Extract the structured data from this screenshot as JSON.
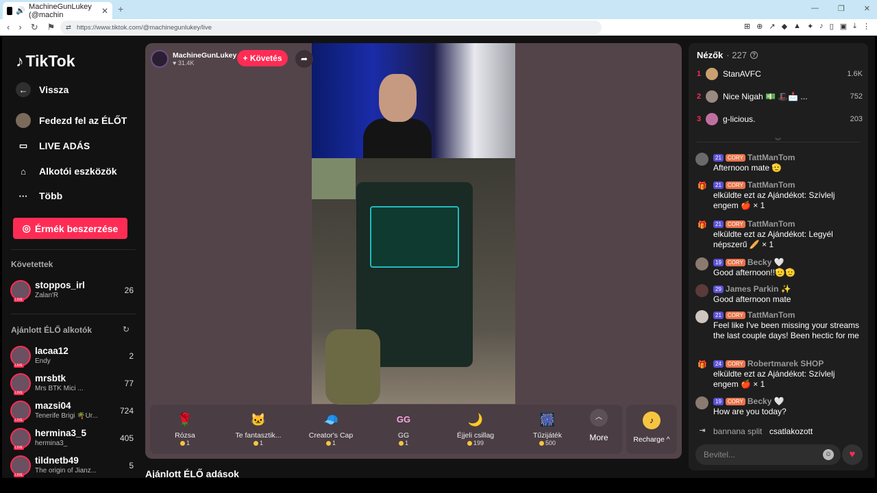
{
  "browser": {
    "tab_title": "MachineGunLukey (@machin",
    "url": "https://www.tiktok.com/@machinegunlukey/live"
  },
  "sidebar": {
    "logo": "TikTok",
    "back": "Vissza",
    "nav": [
      "Fedezd fel az ÉLŐT",
      "LIVE ADÁS",
      "Alkotói eszközök",
      "Több"
    ],
    "coins_button": "Érmék beszerzése",
    "following_title": "Követettek",
    "following": [
      {
        "name": "stoppos_irl",
        "sub": "Zalan'R",
        "count": "26"
      }
    ],
    "recommended_title": "Ajánlott ÉLŐ alkotók",
    "recommended": [
      {
        "name": "lacaa12",
        "sub": "Endy",
        "count": "2"
      },
      {
        "name": "mrsbtk",
        "sub": "Mrs BTK Mici ...",
        "count": "77"
      },
      {
        "name": "mazsi04",
        "sub": "Tenerife Brigi 🌴Úr...",
        "count": "724"
      },
      {
        "name": "hermina3_5",
        "sub": "hermina3_",
        "count": "405"
      },
      {
        "name": "tildnetb49",
        "sub": "The origin of Jianz...",
        "count": "5"
      }
    ]
  },
  "stream": {
    "name": "MachineGunLukey",
    "likes": "31.4K",
    "follow": "+ Követés",
    "gifts": [
      {
        "name": "Rózsa",
        "price": "1",
        "icon": "🌹"
      },
      {
        "name": "Te fantasztik...",
        "price": "1",
        "icon": "🐱"
      },
      {
        "name": "Creator's Cap",
        "price": "1",
        "icon": "🧢"
      },
      {
        "name": "GG",
        "price": "1",
        "icon": "GG"
      },
      {
        "name": "Éjjeli csillag",
        "price": "199",
        "icon": "🌙"
      },
      {
        "name": "Tűzijáték",
        "price": "500",
        "icon": "🎆"
      }
    ],
    "more": "More",
    "recharge": "Recharge ^",
    "suggested_title": "Ajánlott ÉLŐ adások"
  },
  "chat": {
    "viewers_label": "Nézők",
    "viewers_count": "· 227",
    "top": [
      {
        "rank": "1",
        "name": "StanAVFC",
        "score": "1.6K"
      },
      {
        "rank": "2",
        "name": "Nice Nigah 💵 🎩📩 ...",
        "score": "752"
      },
      {
        "rank": "3",
        "name": "g-licious.",
        "score": "203"
      }
    ],
    "messages": [
      {
        "level": "21",
        "fan": "CORY",
        "user": "TattManTom",
        "text": "Afternoon mate 🫡",
        "gift": false
      },
      {
        "level": "21",
        "fan": "CORY",
        "user": "TattManTom",
        "text": "elküldte ezt az Ajándékot: Szívlelj engem 🍎 × 1",
        "gift": true
      },
      {
        "level": "21",
        "fan": "CORY",
        "user": "TattManTom",
        "text": "elküldte ezt az Ajándékot: Legyél népszerű 🥖 × 1",
        "gift": true
      },
      {
        "level": "19",
        "fan": "CORY",
        "user": "Becky 🤍",
        "text": "Good afternoon!!🫡🫡",
        "gift": false
      },
      {
        "level": "29",
        "fan": "",
        "user": "James Parkin ✨",
        "text": "Good afternoon mate",
        "gift": false
      },
      {
        "level": "21",
        "fan": "CORY",
        "user": "TattManTom",
        "text": "Feel like I've been missing your streams the last couple days! Been hectic for me",
        "gift": false
      },
      {
        "level": "24",
        "fan": "CORY",
        "user": "Robertmarek SHOP",
        "text": "elküldte ezt az Ajándékot: Szívlelj engem 🍎 × 1",
        "gift": true
      },
      {
        "level": "19",
        "fan": "CORY",
        "user": "Becky 🤍",
        "text": "How are you today?",
        "gift": false
      }
    ],
    "join_user": "bannana split",
    "join_text": "csatlakozott",
    "input_placeholder": "Bevitel..."
  }
}
